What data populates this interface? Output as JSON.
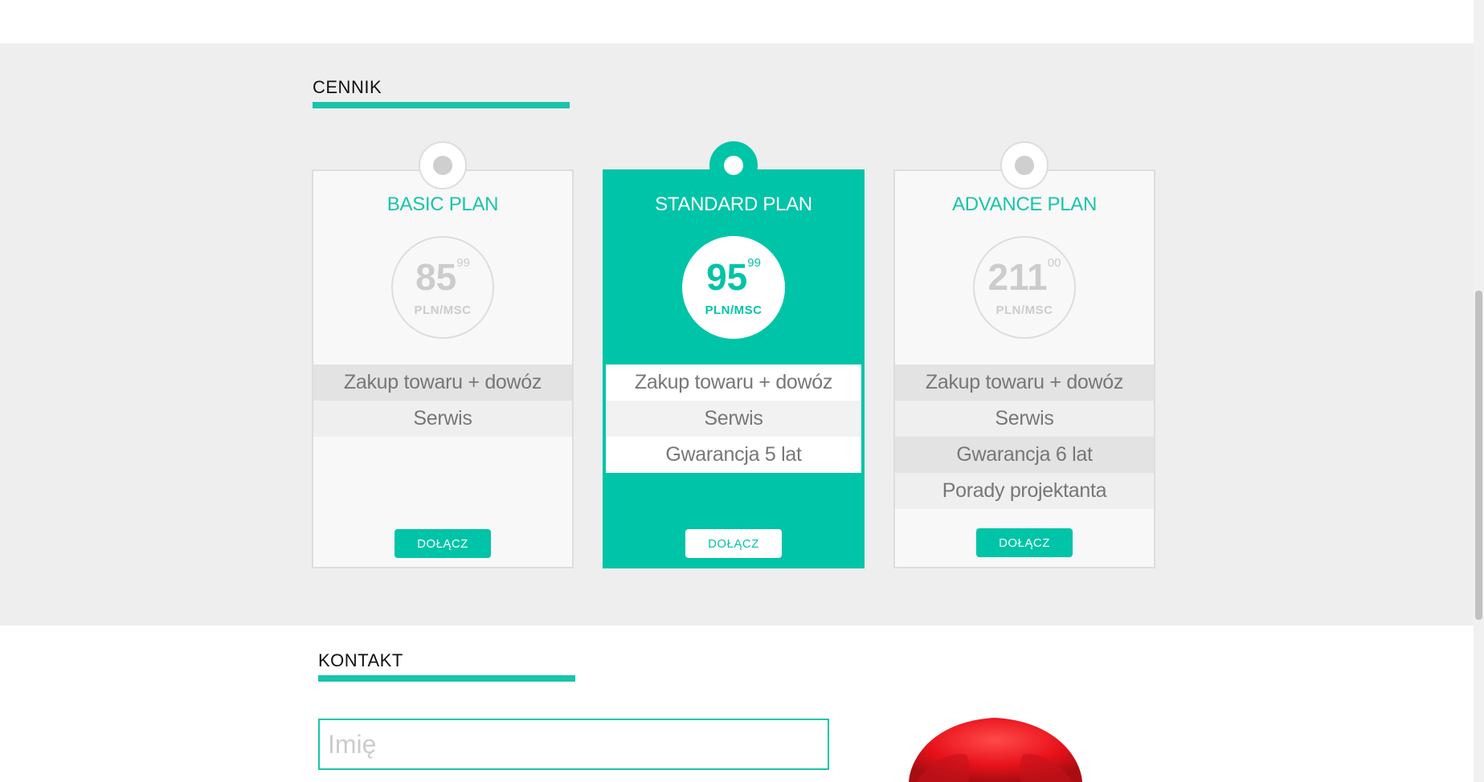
{
  "pricing": {
    "heading": "CENNIK",
    "plans": [
      {
        "title": "BASIC PLAN",
        "price_main": "85",
        "price_cents": "99",
        "unit": "PLN/MSC",
        "features": [
          "Zakup towaru + dowóz",
          "Serwis"
        ],
        "button": "DOŁĄCZ"
      },
      {
        "title": "STANDARD PLAN",
        "price_main": "95",
        "price_cents": "99",
        "unit": "PLN/MSC",
        "features": [
          "Zakup towaru + dowóz",
          "Serwis",
          "Gwarancja 5 lat"
        ],
        "button": "DOŁĄCZ"
      },
      {
        "title": "ADVANCE PLAN",
        "price_main": "211",
        "price_cents": "00",
        "unit": "PLN/MSC",
        "features": [
          "Zakup towaru + dowóz",
          "Serwis",
          "Gwarancja 6 lat",
          "Porady projektanta"
        ],
        "button": "DOŁĄCZ"
      }
    ]
  },
  "contact": {
    "heading": "KONTAKT",
    "name_placeholder": "Imię"
  },
  "colors": {
    "accent": "#00c4a7",
    "section_background": "#eeeeee"
  }
}
